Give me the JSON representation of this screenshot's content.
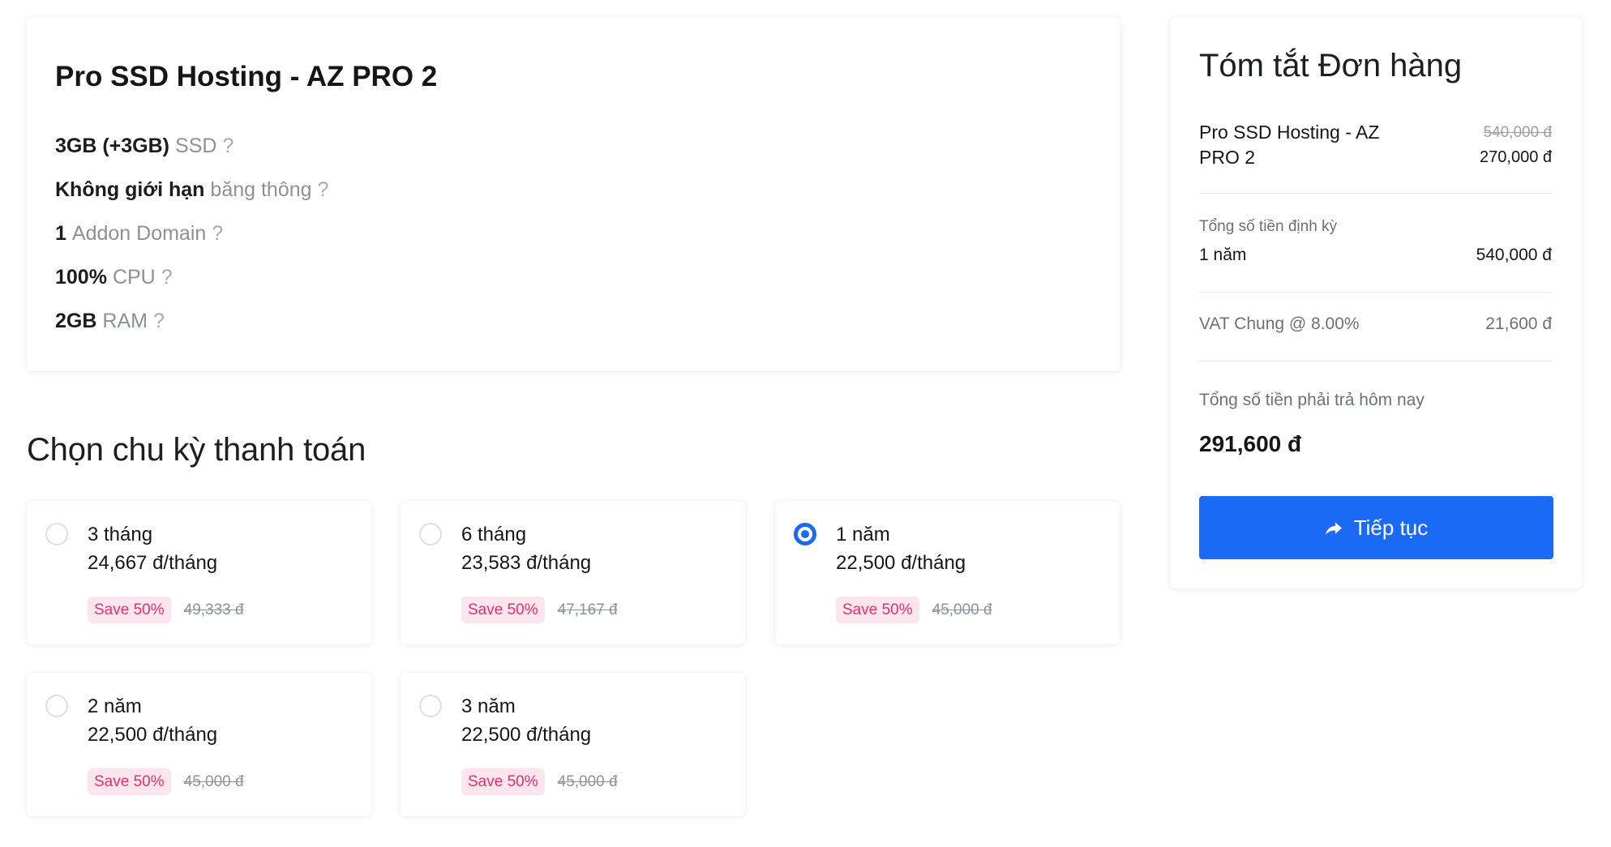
{
  "product": {
    "title": "Pro SSD Hosting - AZ PRO 2",
    "features": [
      {
        "value": "3GB (+3GB)",
        "label": "SSD",
        "help": "?"
      },
      {
        "value": "Không giới hạn",
        "label": "băng thông",
        "help": "?"
      },
      {
        "value": "1",
        "label": "Addon Domain",
        "help": "?"
      },
      {
        "value": "100%",
        "label": "CPU",
        "help": "?"
      },
      {
        "value": "2GB",
        "label": "RAM",
        "help": "?"
      }
    ]
  },
  "billing": {
    "heading": "Chọn chu kỳ thanh toán",
    "options": [
      {
        "term": "3 tháng",
        "price": "24,667 đ/tháng",
        "badge": "Save 50%",
        "old_price": "49,333 đ",
        "selected": false
      },
      {
        "term": "6 tháng",
        "price": "23,583 đ/tháng",
        "badge": "Save 50%",
        "old_price": "47,167 đ",
        "selected": false
      },
      {
        "term": "1 năm",
        "price": "22,500 đ/tháng",
        "badge": "Save 50%",
        "old_price": "45,000 đ",
        "selected": true
      },
      {
        "term": "2 năm",
        "price": "22,500 đ/tháng",
        "badge": "Save 50%",
        "old_price": "45,000 đ",
        "selected": false
      },
      {
        "term": "3 năm",
        "price": "22,500 đ/tháng",
        "badge": "Save 50%",
        "old_price": "45,000 đ",
        "selected": false
      }
    ]
  },
  "summary": {
    "heading": "Tóm tắt Đơn hàng",
    "item_name": "Pro SSD Hosting - AZ PRO 2",
    "item_old_price": "540,000 đ",
    "item_price": "270,000 đ",
    "recurring_label": "Tổng số tiền định kỳ",
    "recurring_term": "1 năm",
    "recurring_amount": "540,000 đ",
    "tax_label": "VAT Chung @ 8.00%",
    "tax_amount": "21,600 đ",
    "due_today_label": "Tổng số tiền phải trả hôm nay",
    "due_today_amount": "291,600 đ",
    "continue_label": "Tiếp tục",
    "continue_icon": "arrow-forward-icon"
  },
  "colors": {
    "accent": "#1a6af5",
    "badge_background": "#fde5ee",
    "badge_text": "#e0336c",
    "muted_text": "#8c9099"
  }
}
